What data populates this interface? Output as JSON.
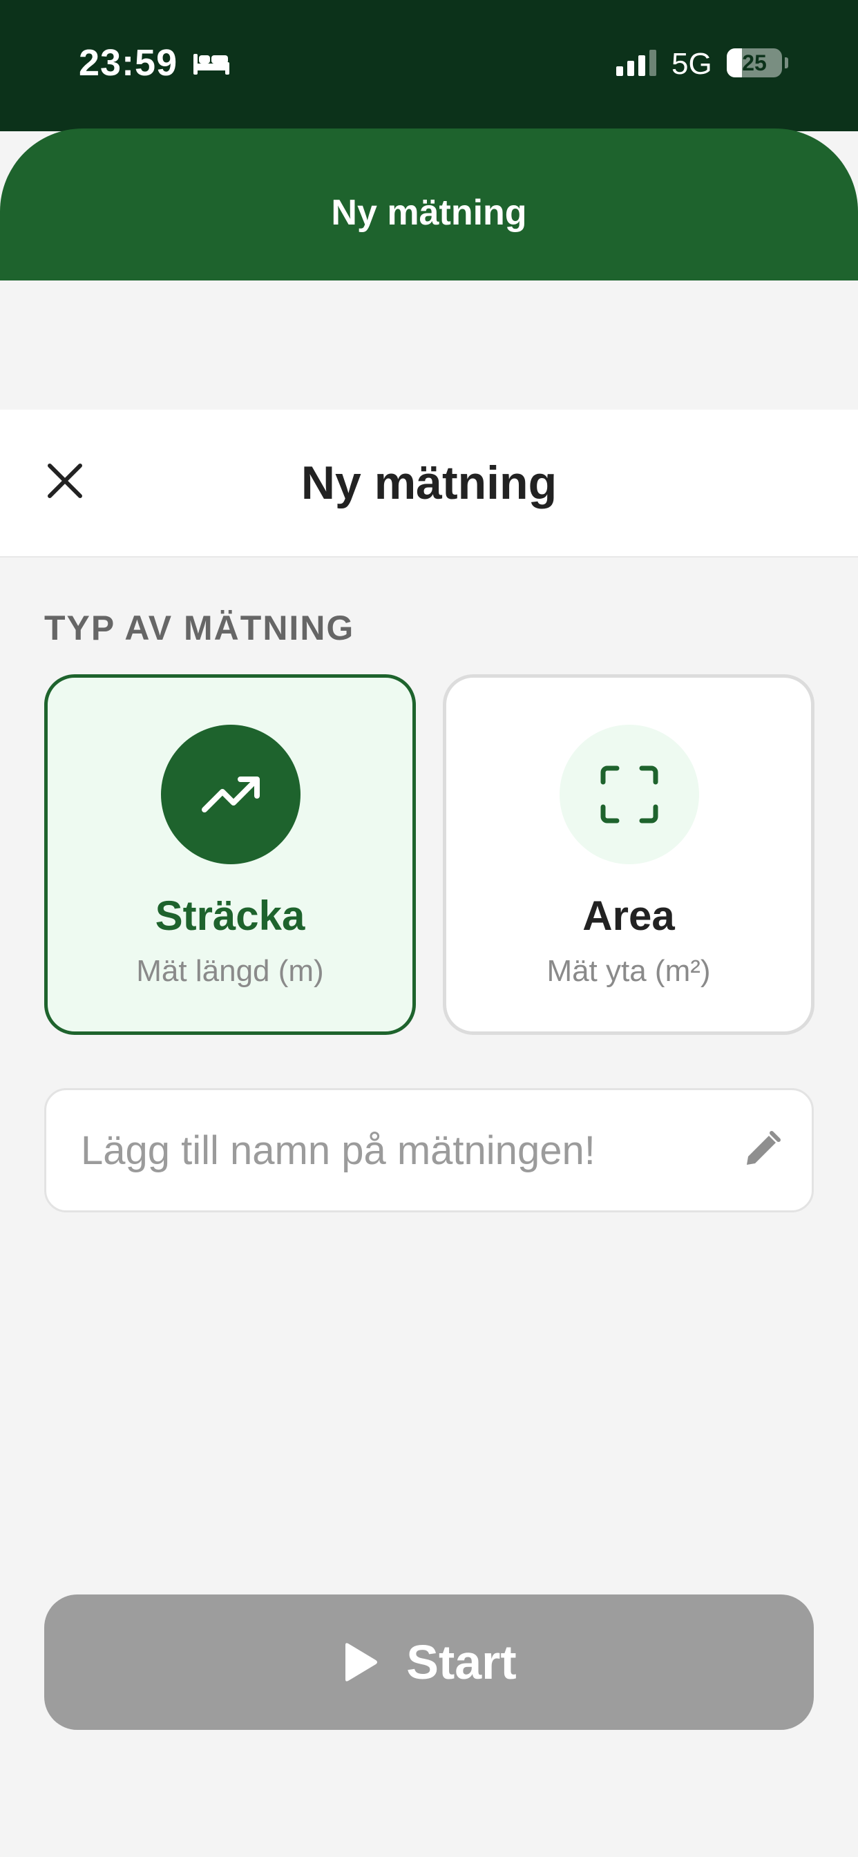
{
  "status_bar": {
    "time": "23:59",
    "network": "5G",
    "battery_level": "25",
    "focus_icon": "bed-icon",
    "signal_icon": "cellular-signal-icon"
  },
  "app_header": {
    "title": "Ny mätning",
    "color": "#1e632d"
  },
  "sheet": {
    "title": "Ny mätning",
    "close_icon": "close-icon",
    "section_label": "TYP AV MÄTNING",
    "types": [
      {
        "title": "Sträcka",
        "subtitle": "Mät längd (m)",
        "icon": "trending-up-icon",
        "selected": true
      },
      {
        "title": "Area",
        "subtitle": "Mät yta (m²)",
        "icon": "scan-frame-icon",
        "selected": false
      }
    ],
    "name_field": {
      "placeholder": "Lägg till namn på mätningen!",
      "value": "",
      "icon": "pencil-icon"
    },
    "start_button": {
      "label": "Start",
      "icon": "play-icon",
      "color": "#9d9d9d"
    }
  }
}
